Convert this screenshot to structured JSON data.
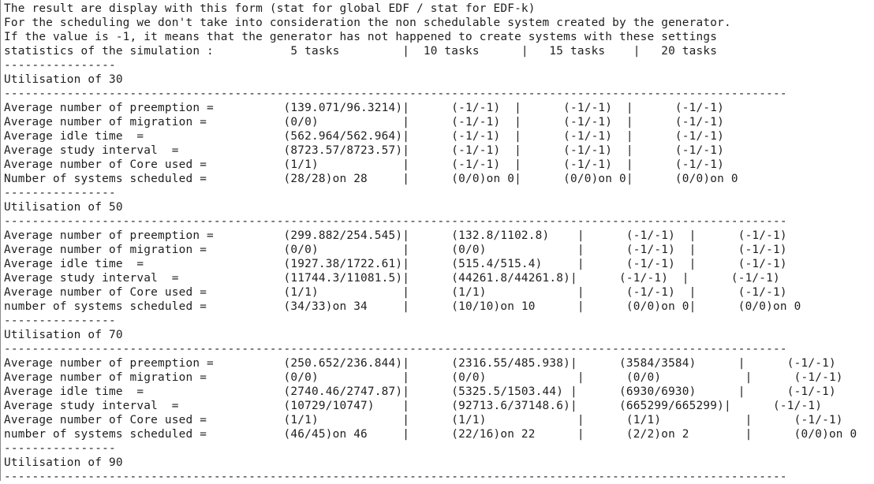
{
  "lines": [
    "The result are display with this form (stat for global EDF / stat for EDF-k)",
    "For the scheduling we don't take into consideration the non schedulable system created by the generator.",
    "If the value is -1, it means that the generator has not happened to create systems with these settings",
    "statistics of the simulation :           5 tasks         |  10 tasks      |   15 tasks    |   20 tasks",
    "----------------",
    "Utilisation of 30",
    "----------------------------------------------------------------------------------------------------------------",
    "Average number of preemption =          (139.071/96.3214)|      (-1/-1)  |      (-1/-1)  |      (-1/-1)",
    "Average number of migration =           (0/0)            |      (-1/-1)  |      (-1/-1)  |      (-1/-1)",
    "Average idle time  =                    (562.964/562.964)|      (-1/-1)  |      (-1/-1)  |      (-1/-1)",
    "Average study interval  =               (8723.57/8723.57)|      (-1/-1)  |      (-1/-1)  |      (-1/-1)",
    "Average number of Core used =           (1/1)            |      (-1/-1)  |      (-1/-1)  |      (-1/-1)",
    "Number of systems scheduled =           (28/28)on 28     |      (0/0)on 0|      (0/0)on 0|      (0/0)on 0",
    "----------------",
    "Utilisation of 50",
    "----------------------------------------------------------------------------------------------------------------",
    "Average number of preemption =          (299.882/254.545)|      (132.8/1102.8)    |      (-1/-1)  |      (-1/-1)",
    "Average number of migration =           (0/0)            |      (0/0)             |      (-1/-1)  |      (-1/-1)",
    "Average idle time  =                    (1927.38/1722.61)|      (515.4/515.4)     |      (-1/-1)  |      (-1/-1)",
    "Average study interval  =               (11744.3/11081.5)|      (44261.8/44261.8)|      (-1/-1)  |      (-1/-1)",
    "Average number of Core used =           (1/1)            |      (1/1)             |      (-1/-1)  |      (-1/-1)",
    "number of systems scheduled =           (34/33)on 34     |      (10/10)on 10      |      (0/0)on 0|      (0/0)on 0",
    "----------------",
    "Utilisation of 70",
    "----------------------------------------------------------------------------------------------------------------",
    "Average number of preemption =          (250.652/236.844)|      (2316.55/485.938)|      (3584/3584)      |      (-1/-1)",
    "Average number of migration =           (0/0)            |      (0/0)             |      (0/0)            |      (-1/-1)",
    "Average idle time  =                    (2740.46/2747.87)|      (5325.5/1503.44) |      (6930/6930)      |      (-1/-1)",
    "Average study interval  =               (10729/10747)    |      (92713.6/37148.6)|      (665299/665299)|      (-1/-1)",
    "Average number of Core used =           (1/1)            |      (1/1)             |      (1/1)            |      (-1/-1)",
    "number of systems scheduled =           (46/45)on 46     |      (22/16)on 22      |      (2/2)on 2        |      (0/0)on 0",
    "----------------",
    "Utilisation of 90",
    "----------------------------------------------------------------------------------------------------------------"
  ]
}
